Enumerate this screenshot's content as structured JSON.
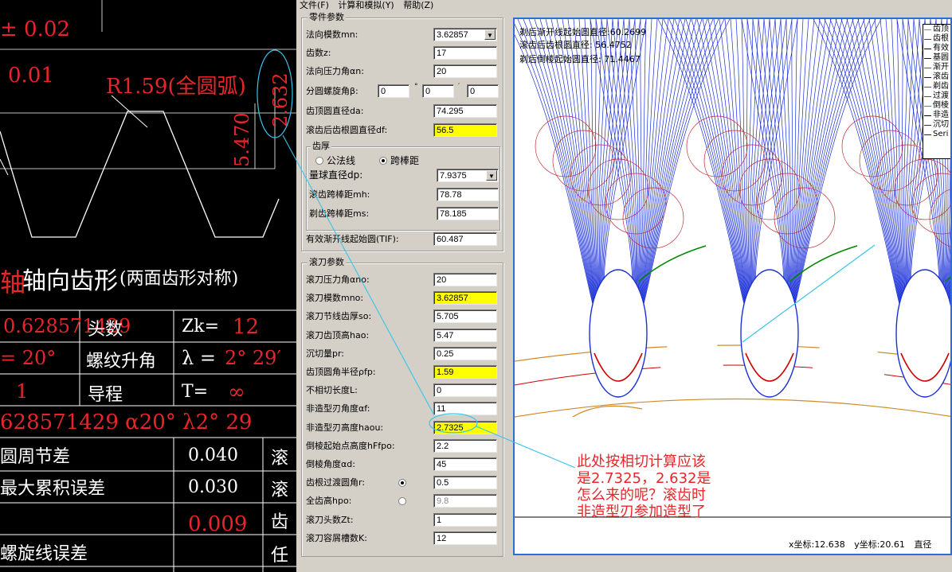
{
  "menu": [
    "文件(F)",
    "计算和模拟(Y)",
    "帮助(Z)"
  ],
  "cad": {
    "tol1": "± 0.02",
    "tol2": "0.01",
    "radius_label": "R1.59(全圆弧)",
    "dim_5470": "5.470",
    "dim_2632": "2.632",
    "axial_title": "轴向齿形",
    "axial_note": "(两面齿形对称)",
    "table": {
      "r1": [
        "0.628571429",
        "头数",
        "Zk=",
        "12"
      ],
      "r2": [
        "= 20°",
        "螺纹升角",
        "λ =",
        "2° 29′"
      ],
      "r3": [
        "1",
        "导程",
        "T=",
        "∞"
      ],
      "r4": "628571429  α20°  λ2°  29",
      "rows": [
        {
          "label": "圆周节差",
          "value": "0.040",
          "right": "滚"
        },
        {
          "label": "最大累积误差",
          "value": "0.030",
          "right": "滚"
        },
        {
          "label": "",
          "value": "0.009",
          "right": "齿"
        },
        {
          "label": "螺旋线误差",
          "value": "",
          "right": "任"
        }
      ]
    }
  },
  "part_params": {
    "title": "零件参数",
    "normal_module": {
      "label": "法向模数mn:",
      "value": "3.62857"
    },
    "teeth": {
      "label": "齿数z:",
      "value": "17"
    },
    "pressure_angle": {
      "label": "法向压力角αn:",
      "value": "20"
    },
    "helix": {
      "label": "分圆螺旋角β:",
      "v1": "0",
      "v2": "0",
      "v3": "0"
    },
    "tip_diameter": {
      "label": "齿顶圆直径da:",
      "value": "74.295"
    },
    "root_diameter": {
      "label": "滚齿后齿根圆直径df:",
      "value": "56.5"
    },
    "thickness": {
      "title": "齿厚",
      "opt1": "公法线",
      "opt2": "跨棒距",
      "ball_dia": {
        "label": "量球直径dp:",
        "value": "7.9375"
      },
      "hob_mh": {
        "label": "滚齿跨棒距mh:",
        "value": "78.78"
      },
      "shave_ms": {
        "label": "剃齿跨棒距ms:",
        "value": "78.185"
      }
    },
    "tif": {
      "label": "有效渐开线起始圆(TIF):",
      "value": "60.487"
    }
  },
  "hob_params": {
    "title": "滚刀参数",
    "rows": [
      {
        "label": "滚刀压力角αno:",
        "value": "20",
        "hl": false
      },
      {
        "label": "滚刀模数mno:",
        "value": "3.62857",
        "hl": true
      },
      {
        "label": "滚刀节线齿厚so:",
        "value": "5.705",
        "hl": false
      },
      {
        "label": "滚刀齿顶高hao:",
        "value": "5.47",
        "hl": false
      },
      {
        "label": "沉切量pr:",
        "value": "0.25",
        "hl": false
      },
      {
        "label": "齿顶圆角半径ρfp:",
        "value": "1.59",
        "hl": true
      },
      {
        "label": "不相切长度L:",
        "value": "0",
        "hl": false
      },
      {
        "label": "非造型刃角度αf:",
        "value": "11",
        "hl": false
      },
      {
        "label": "非造型刃高度haou:",
        "value": "2.7325",
        "hl": true
      },
      {
        "label": "倒棱起始点高度hFfpo:",
        "value": "2.2",
        "hl": false
      },
      {
        "label": "倒棱角度αd:",
        "value": "45",
        "hl": false
      },
      {
        "label": "齿根过渡圆角r:",
        "value": "0.5",
        "hl": false
      },
      {
        "label": "全齿高hpo:",
        "value": "9.8",
        "hl": false
      },
      {
        "label": "滚刀头数Zt:",
        "value": "1",
        "hl": false
      },
      {
        "label": "滚刀容屑槽数K:",
        "value": "12",
        "hl": false
      }
    ]
  },
  "plot": {
    "info1": "剃后渐开线起始圆直径:60.2699",
    "info2": "滚齿后齿根圆直径:   56.4752",
    "info3": "剃后倒棱起始圆直径:   71.4467",
    "legend": [
      "齿顶",
      "齿根",
      "有效",
      "基圆",
      "渐开",
      "滚齿",
      "剃齿",
      "过渡",
      "倒棱",
      "非造",
      "沉切",
      "Seri"
    ],
    "annotation": "此处按相切计算应该\n是2.7325，2.632是\n怎么来的呢？滚齿时\n非造型刃参加造型了",
    "x_coord": "x坐标:12.638",
    "y_coord": "y坐标:20.61",
    "extra": "直径"
  },
  "colors": {
    "accent": "#2a6fd6",
    "highlight": "#ffff00",
    "annot": "#e8252a"
  }
}
